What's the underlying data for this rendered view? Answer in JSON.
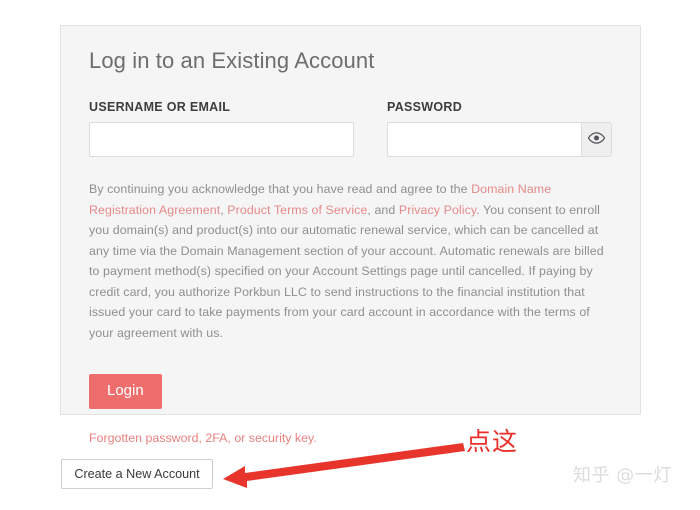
{
  "login_card": {
    "title": "Log in to an Existing Account",
    "username_label": "USERNAME OR EMAIL",
    "username_value": "",
    "password_label": "PASSWORD",
    "password_value": "",
    "toggle_password_icon": "eye-icon",
    "legal": {
      "part1": "By continuing you acknowledge that you have read and agree to the ",
      "link1": "Domain Name Registration Agreement",
      "part2": ", ",
      "link2": "Product Terms of Service",
      "part3": ", and ",
      "link3": "Privacy Policy",
      "part4": ". You consent to enroll you domain(s) and product(s) into our automatic renewal service, which can be cancelled at any time via the Domain Management section of your account. Automatic renewals are billed to payment method(s) specified on your Account Settings page until cancelled. If paying by credit card, you authorize Porkbun LLC to send instructions to the financial institution that issued your card to take payments from your card account in accordance with the terms of your agreement with us."
    },
    "login_button": "Login",
    "forgot_link": "Forgotten password, 2FA, or security key."
  },
  "create_account": {
    "label": "Create a New Account"
  },
  "annotation": {
    "text": "点这",
    "arrow_icon": "left-arrow-icon"
  },
  "watermark": {
    "text": "知乎 @一灯"
  },
  "colors": {
    "panel_background": "#f5f5f5",
    "panel_border": "#e2e2e2",
    "login_button": "#ee6e6e",
    "link": "#e58a8a",
    "forgot_link": "#e9817f",
    "body_text": "#8f8f8f",
    "annotation_red": "#e8312a",
    "watermark": "#dcdcdc"
  }
}
